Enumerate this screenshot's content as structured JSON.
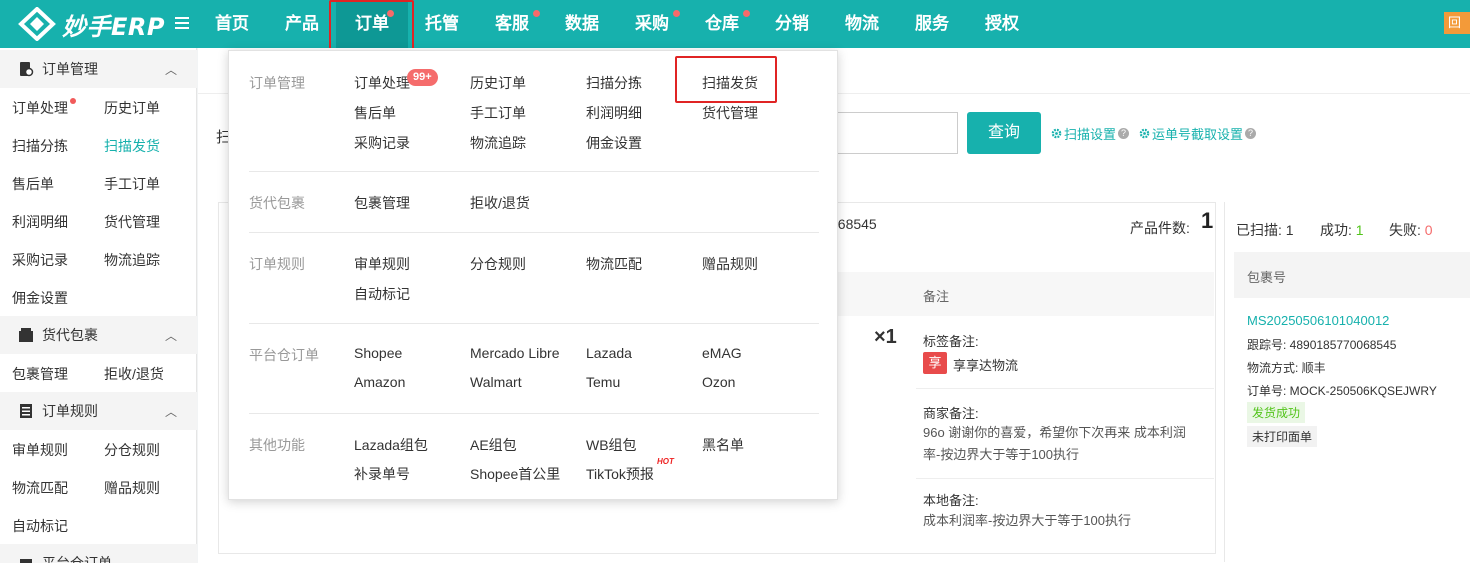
{
  "app": {
    "logo_text": "妙手ERP"
  },
  "topnav": {
    "items": [
      {
        "label": "首页"
      },
      {
        "label": "产品"
      },
      {
        "label": "订单"
      },
      {
        "label": "托管"
      },
      {
        "label": "客服"
      },
      {
        "label": "数据"
      },
      {
        "label": "采购"
      },
      {
        "label": "仓库"
      },
      {
        "label": "分销"
      },
      {
        "label": "物流"
      },
      {
        "label": "服务"
      },
      {
        "label": "授权"
      }
    ],
    "corner_badge": "回"
  },
  "sidebar": {
    "groups": [
      {
        "label": "订单管理",
        "items": [
          "订单处理",
          "历史订单",
          "扫描分拣",
          "扫描发货",
          "售后单",
          "手工订单",
          "利润明细",
          "货代管理",
          "采购记录",
          "物流追踪",
          "佣金设置"
        ]
      },
      {
        "label": "货代包裹",
        "items": [
          "包裹管理",
          "拒收/退货"
        ]
      },
      {
        "label": "订单规则",
        "items": [
          "审单规则",
          "分仓规则",
          "物流匹配",
          "赠品规则",
          "自动标记"
        ]
      },
      {
        "label": "平台仓订单"
      }
    ]
  },
  "main": {
    "scan_label": "扫",
    "query_button": "查询",
    "scan_settings": "扫描设置",
    "waybill_settings": "运单号截取设置",
    "tracking_tail": "068545",
    "product_count_label": "产品件数:",
    "product_count": "1",
    "remark_header": "备注",
    "quantity": "×1",
    "tag_remark_title": "标签备注:",
    "share_badge": "享",
    "share_text": "享享达物流",
    "merchant_remark_title": "商家备注:",
    "merchant_remark": "96o 谢谢你的喜爱，希望你下次再来 成本利润率-按边界大于等于100执行",
    "local_remark_title": "本地备注:",
    "local_remark": "成本利润率-按边界大于等于100执行"
  },
  "rightpanel": {
    "scanned_label": "已扫描:",
    "scanned": "1",
    "success_label": "成功:",
    "success": "1",
    "fail_label": "失败:",
    "fail": "0",
    "package_header": "包裹号",
    "package_no": "MS20250506101040012",
    "tracking": "跟踪号:  4890185770068545",
    "shipping": "物流方式:  顺丰",
    "order_no": "订单号:  MOCK-250506KQSEJWRY",
    "status_shipped": "发货成功",
    "status_unprinted": "未打印面单"
  },
  "dropdown": {
    "sections": [
      {
        "label": "订单管理",
        "items": [
          "订单处理",
          "历史订单",
          "扫描分拣",
          "扫描发货",
          "售后单",
          "手工订单",
          "利润明细",
          "货代管理",
          "采购记录",
          "物流追踪",
          "佣金设置"
        ]
      },
      {
        "label": "货代包裹",
        "items": [
          "包裹管理",
          "拒收/退货"
        ]
      },
      {
        "label": "订单规则",
        "items": [
          "审单规则",
          "分仓规则",
          "物流匹配",
          "赠品规则",
          "自动标记"
        ]
      },
      {
        "label": "平台仓订单",
        "items": [
          "Shopee",
          "Mercado Libre",
          "Lazada",
          "eMAG",
          "Amazon",
          "Walmart",
          "Temu",
          "Ozon"
        ]
      },
      {
        "label": "其他功能",
        "items": [
          "Lazada组包",
          "AE组包",
          "WB组包",
          "黑名单",
          "补录单号",
          "Shopee首公里",
          "TikTok预报"
        ]
      }
    ],
    "badge_99": "99+",
    "hot_label": "HOT"
  },
  "colors": {
    "brand": "#17b1ad",
    "highlight": "#e02424",
    "badge": "#f56c6c"
  }
}
